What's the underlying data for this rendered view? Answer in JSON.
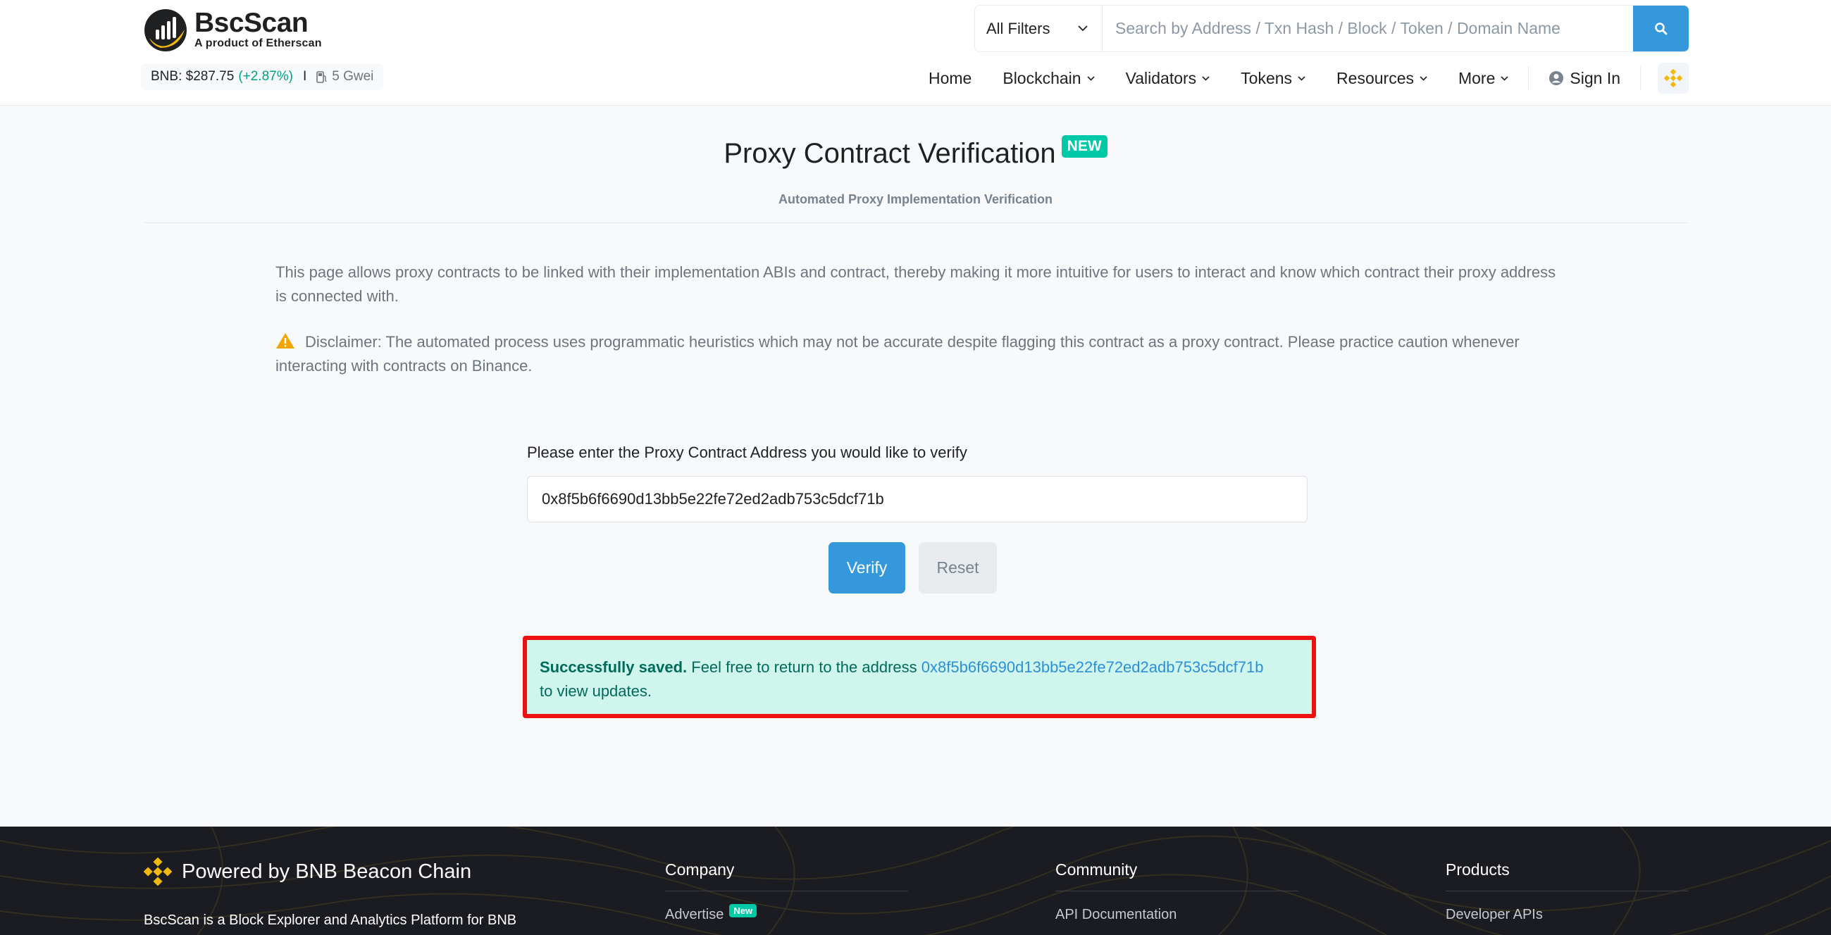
{
  "header": {
    "brand": "BscScan",
    "tagline": "A product of Etherscan",
    "price_label": "BNB: $287.75",
    "price_change": "(+2.87%)",
    "separator": "I",
    "gas": "5 Gwei",
    "filter_label": "All Filters",
    "search_placeholder": "Search by Address / Txn Hash / Block / Token / Domain Name",
    "nav": {
      "home": "Home",
      "blockchain": "Blockchain",
      "validators": "Validators",
      "tokens": "Tokens",
      "resources": "Resources",
      "more": "More",
      "signin": "Sign In"
    }
  },
  "main": {
    "title": "Proxy Contract Verification",
    "badge": "NEW",
    "subtitle": "Automated Proxy Implementation Verification",
    "description": "This page allows proxy contracts to be linked with their implementation ABIs and contract, thereby making it more intuitive for users to interact and know which contract their proxy address is connected with.",
    "disclaimer": "Disclaimer: The automated process uses programmatic heuristics which may not be accurate despite flagging this contract as a proxy contract. Please practice caution whenever interacting with contracts on Binance.",
    "form_label": "Please enter the Proxy Contract Address you would like to verify",
    "address_value": "0x8f5b6f6690d13bb5e22fe72ed2adb753c5dcf71b",
    "verify_label": "Verify",
    "reset_label": "Reset",
    "alert": {
      "bold": "Successfully saved.",
      "text": "Feel free to return to the address",
      "link": "0x8f5b6f6690d13bb5e22fe72ed2adb753c5dcf71b",
      "tail": "to view updates."
    }
  },
  "footer": {
    "brand": "Powered by BNB Beacon Chain",
    "description": "BscScan is a Block Explorer and Analytics Platform for BNB",
    "company_title": "Company",
    "company_link": "Advertise",
    "company_badge": "New",
    "community_title": "Community",
    "community_link": "API Documentation",
    "products_title": "Products",
    "products_link": "Developer APIs"
  },
  "colors": {
    "accent": "#3498db",
    "success": "#00c9a7",
    "alert_bg": "#cff5ec",
    "highlight_frame": "#ee1111",
    "bnb_yellow": "#f0b90b",
    "footer_bg": "#1a1c22"
  }
}
